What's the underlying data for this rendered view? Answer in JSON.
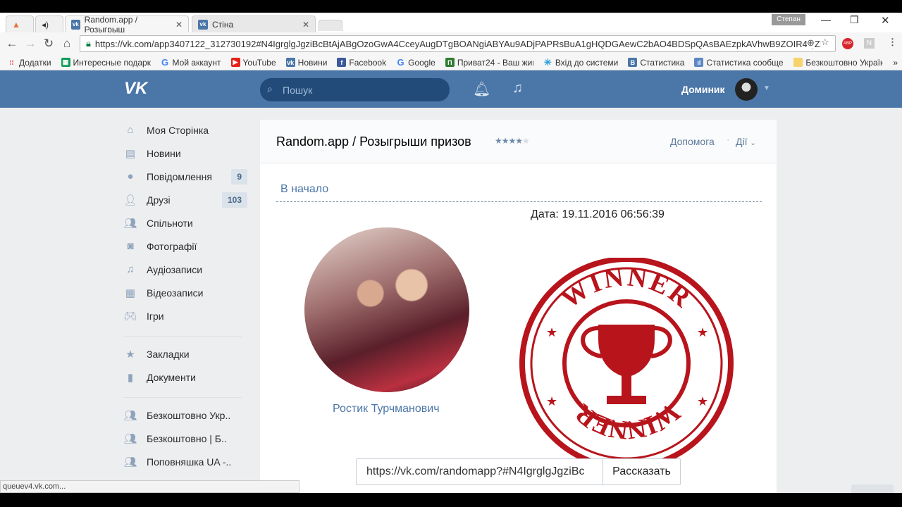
{
  "browser": {
    "tabs": [
      {
        "label": "Random.app / Розыгрыш"
      },
      {
        "label": "Стіна"
      }
    ],
    "profile_name": "Степан",
    "url": "https://vk.com/app3407122_312730192#N4IgrglgJgziBcBtAjABgOzoGwA4CceyAugDTgBOANgiABYAu9ADjPAPRsBuA1gHQDGAewC2bAO4BDSpQAsBAEzpkAVhwB9ZOIR4QZK",
    "bookmarks": [
      "Додатки",
      "Интересные подарки",
      "Мой аккаунт",
      "YouTube",
      "Новини",
      "Facebook",
      "Google",
      "Приват24 - Ваш живий",
      "Вхід до системи",
      "Статистика",
      "Статистика сообщест",
      "Безкоштовно Україна"
    ],
    "status_text": "queuev4.vk.com..."
  },
  "header": {
    "search_placeholder": "Пошук",
    "user_name": "Доминик",
    "brand_color": "#4a76a8"
  },
  "sidebar": {
    "items": [
      {
        "label": "Моя Сторінка",
        "icon": "home-icon"
      },
      {
        "label": "Новини",
        "icon": "news-icon"
      },
      {
        "label": "Повідомлення",
        "icon": "messages-icon",
        "badge": "9"
      },
      {
        "label": "Друзі",
        "icon": "friends-icon",
        "badge": "103"
      },
      {
        "label": "Спільноти",
        "icon": "groups-icon"
      },
      {
        "label": "Фотографії",
        "icon": "camera-icon"
      },
      {
        "label": "Аудіозаписи",
        "icon": "music-icon"
      },
      {
        "label": "Відеозаписи",
        "icon": "video-icon"
      },
      {
        "label": "Ігри",
        "icon": "gamepad-icon"
      },
      {
        "label": "Закладки",
        "icon": "star-icon"
      },
      {
        "label": "Документи",
        "icon": "document-icon"
      },
      {
        "label": "Безкоштовно Укр..",
        "icon": "group-icon"
      },
      {
        "label": "Безкоштовно | Б..",
        "icon": "group-icon"
      },
      {
        "label": "Поповняшка UA -..",
        "icon": "group-icon"
      }
    ]
  },
  "app": {
    "title": "Random.app / Розыгрыши призов",
    "rating": 4,
    "rating_max": 5,
    "help": "Допомога",
    "actions": "Дії",
    "back_link": "В начало",
    "date": "Дата: 19.11.2016 06:56:39",
    "winner_name": "Ростик Турчманович",
    "stamp_text": "WINNER",
    "share_url": "https://vk.com/randomapp?#N4IgrglgJgziBc",
    "share_button": "Рассказать"
  }
}
